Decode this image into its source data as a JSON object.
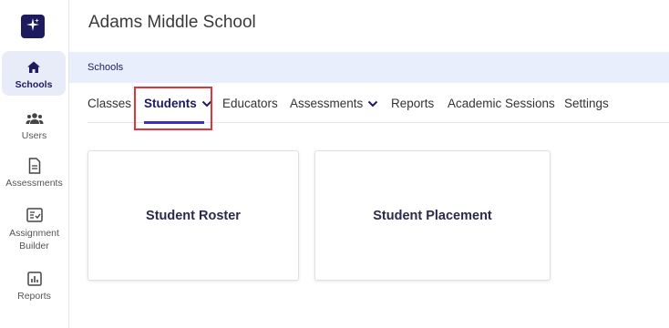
{
  "app": {
    "logo_icon": "sparkle-icon"
  },
  "sidebar": {
    "items": [
      {
        "label": "Schools",
        "icon": "home-icon",
        "active": true
      },
      {
        "label": "Users",
        "icon": "users-icon"
      },
      {
        "label": "Assessments",
        "icon": "document-icon"
      },
      {
        "label": "Assignment Builder",
        "icon": "checklist-icon"
      },
      {
        "label": "Reports",
        "icon": "bar-chart-icon"
      }
    ]
  },
  "header": {
    "title": "Adams Middle School"
  },
  "breadcrumb": {
    "label": "Schools"
  },
  "tabs": [
    {
      "label": "Classes"
    },
    {
      "label": "Students",
      "active": true,
      "has_dropdown": true
    },
    {
      "label": "Educators"
    },
    {
      "label": "Assessments",
      "has_dropdown": true
    },
    {
      "label": "Reports"
    },
    {
      "label": "Academic Sessions"
    },
    {
      "label": "Settings"
    }
  ],
  "cards": [
    {
      "label": "Student Roster"
    },
    {
      "label": "Student Placement"
    }
  ],
  "colors": {
    "brand": "#1e1a5e",
    "accent": "#3b2fbf",
    "highlight": "#e0353a",
    "breadcrumb_bg": "#e8eefb"
  }
}
